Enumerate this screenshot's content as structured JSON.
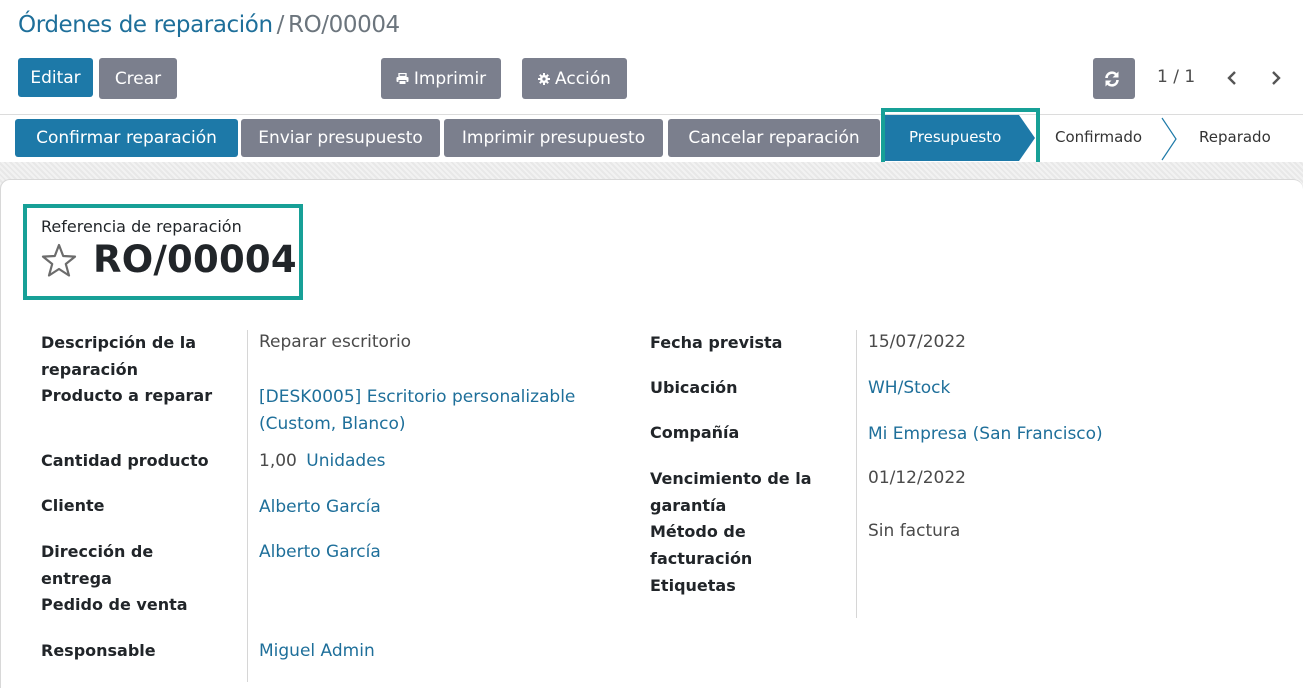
{
  "breadcrumb": {
    "parent": "Órdenes de reparación",
    "separator": "/",
    "current": "RO/00004"
  },
  "control_panel": {
    "edit_label": "Editar",
    "create_label": "Crear",
    "print_label": "Imprimir",
    "action_label": "Acción",
    "pager_value": "1 / 1"
  },
  "statusbar": {
    "buttons": {
      "confirm": "Confirmar reparación",
      "send_quote": "Enviar presupuesto",
      "print_quote": "Imprimir presupuesto",
      "cancel": "Cancelar reparación"
    },
    "stages": [
      "Presupuesto",
      "Confirmado",
      "Reparado"
    ],
    "active_stage": "Presupuesto"
  },
  "title": {
    "label": "Referencia de reparación",
    "value": "RO/00004"
  },
  "left_fields": {
    "description": {
      "label": "Descripción de la reparación",
      "value": "Reparar escritorio"
    },
    "product": {
      "label": "Producto a reparar",
      "value_line1": "[DESK0005] Escritorio personalizable",
      "value_line2": "(Custom, Blanco)"
    },
    "quantity": {
      "label": "Cantidad producto",
      "value": "1,00",
      "uom": "Unidades"
    },
    "customer": {
      "label": "Cliente",
      "value": "Alberto García"
    },
    "delivery_address": {
      "label": "Dirección de entrega",
      "value": "Alberto García"
    },
    "sale_order": {
      "label": "Pedido de venta",
      "value": ""
    },
    "responsible": {
      "label": "Responsable",
      "value": "Miguel Admin"
    }
  },
  "right_fields": {
    "scheduled_date": {
      "label": "Fecha prevista",
      "value": "15/07/2022"
    },
    "location": {
      "label": "Ubicación",
      "value": "WH/Stock"
    },
    "company": {
      "label": "Compañía",
      "value": "Mi Empresa (San Francisco)"
    },
    "warranty": {
      "label": "Vencimiento de la garantía",
      "value": "01/12/2022"
    },
    "invoice_method": {
      "label": "Método de facturación",
      "value": "Sin factura"
    },
    "tags": {
      "label": "Etiquetas",
      "value": ""
    }
  },
  "colors": {
    "primary": "#1d79a8",
    "secondary": "#7b7f8d",
    "link": "#1e6f9a",
    "highlight": "#17a097"
  },
  "icons": {
    "print": "print-icon",
    "action": "gear-icon",
    "reload": "refresh-icon",
    "pager_prev": "chevron-left-icon",
    "pager_next": "chevron-right-icon",
    "favorite": "star-icon"
  }
}
